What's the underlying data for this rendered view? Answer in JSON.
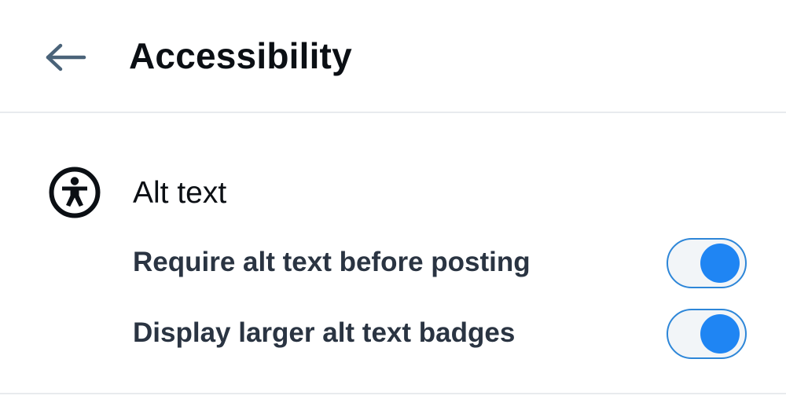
{
  "header": {
    "back_icon": "arrow-left-icon",
    "title": "Accessibility"
  },
  "section": {
    "icon": "accessibility-person-icon",
    "title": "Alt text",
    "settings": [
      {
        "label": "Require alt text before posting",
        "enabled": true
      },
      {
        "label": "Display larger alt text badges",
        "enabled": true
      }
    ]
  },
  "colors": {
    "accent": "#1f85f3",
    "toggle_border": "#2d86d8",
    "toggle_track": "#f2f5f8",
    "title_text": "#0b0f14",
    "label_text": "#2a3442",
    "back_arrow": "#4a6379",
    "divider": "#e8ebee"
  }
}
